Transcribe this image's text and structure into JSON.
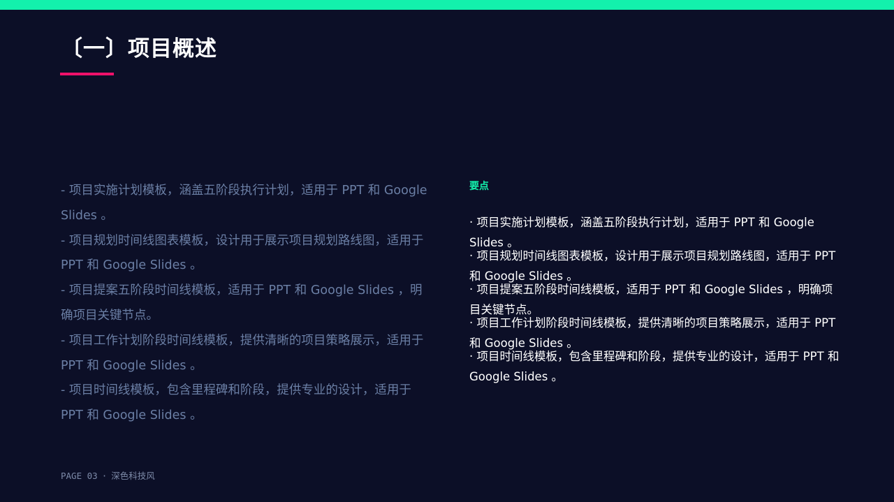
{
  "colors": {
    "background": "#0c0f27",
    "accent_green": "#13f1ac",
    "accent_pink": "#f0116b",
    "muted_text": "#6b7fa5",
    "white_text": "#ffffff"
  },
  "title": "〔一〕项目概述",
  "left_items": [
    "- 项目实施计划模板，涵盖五阶段执行计划，适用于 PPT 和 Google Slides 。",
    "- 项目规划时间线图表模板，设计用于展示项目规划路线图，适用于 PPT 和 Google Slides 。",
    "- 项目提案五阶段时间线模板，适用于 PPT 和 Google Slides ，明确项目关键节点。",
    "- 项目工作计划阶段时间线模板，提供清晰的项目策略展示，适用于 PPT 和 Google Slides 。",
    "- 项目时间线模板，包含里程碑和阶段，提供专业的设计，适用于 PPT 和 Google Slides 。"
  ],
  "points_heading": "要点",
  "right_items": [
    "· 项目实施计划模板，涵盖五阶段执行计划，适用于 PPT 和 Google Slides 。",
    "· 项目规划时间线图表模板，设计用于展示项目规划路线图，适用于 PPT 和 Google Slides 。",
    "· 项目提案五阶段时间线模板，适用于 PPT 和 Google Slides ，明确项目关键节点。",
    "· 项目工作计划阶段时间线模板，提供清晰的项目策略展示，适用于 PPT 和 Google Slides 。",
    "· 项目时间线模板，包含里程碑和阶段，提供专业的设计，适用于 PPT 和 Google Slides 。"
  ],
  "footer": {
    "page": "PAGE 03",
    "separator": "·",
    "theme": "深色科技风"
  }
}
